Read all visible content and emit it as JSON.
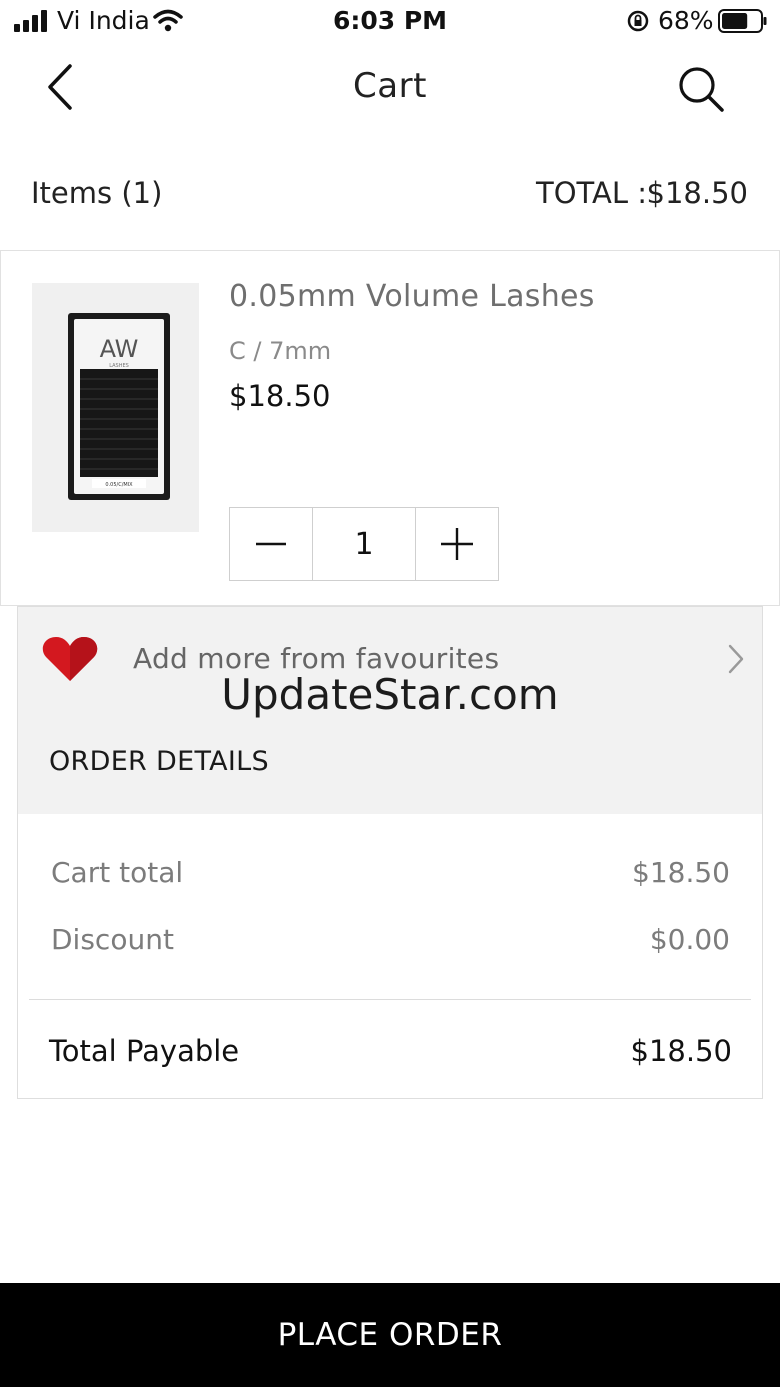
{
  "status_bar": {
    "carrier": "Vi India",
    "time": "6:03 PM",
    "battery_percent": "68%",
    "battery_level": 0.68,
    "icons": [
      "signal-icon",
      "wifi-icon",
      "orientation-lock-icon",
      "battery-icon"
    ]
  },
  "nav": {
    "title": "Cart",
    "back_icon": "chevron-left-icon",
    "search_icon": "search-icon"
  },
  "summary": {
    "items_label": "Items (1)",
    "total_label": "TOTAL :",
    "total_value": "$18.50"
  },
  "cart_item": {
    "name": "0.05mm Volume Lashes",
    "variant": "C / 7mm",
    "price": "$18.50",
    "quantity": "1",
    "minus_icon": "minus-icon",
    "plus_icon": "plus-icon",
    "image_brand_text": "AW",
    "image_sub_text": "LASHES",
    "image_label_text": "0.05/C/MIX"
  },
  "favourites": {
    "label": "Add more from favourites",
    "icon": "heart-icon",
    "chevron_icon": "chevron-right-icon"
  },
  "watermark": "UpdateStar.com",
  "order_details": {
    "title": "ORDER DETAILS",
    "rows": [
      {
        "label": "Cart total",
        "value": "$18.50"
      },
      {
        "label": "Discount",
        "value": "$0.00"
      }
    ],
    "total_label": "Total Payable",
    "total_value": "$18.50"
  },
  "footer": {
    "place_order_label": "PLACE ORDER"
  },
  "colors": {
    "heart": "#d3181f",
    "footer_bg": "#000000",
    "panel_bg": "#f2f2f2"
  }
}
